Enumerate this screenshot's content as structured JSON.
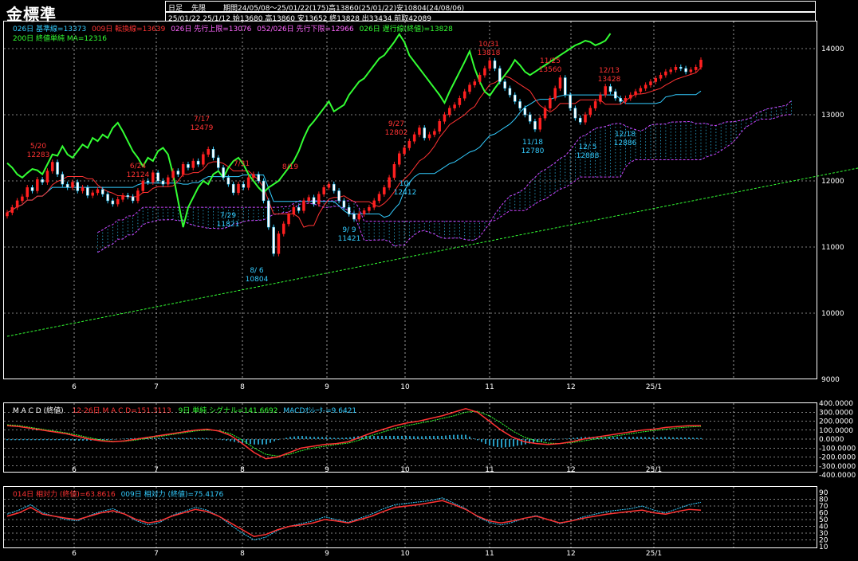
{
  "title": "金標準",
  "header": {
    "period_type": "日足",
    "contract": "先限",
    "range_info": "期間24/05/08～25/01/22(175)高13860(25/01/22)安10804(24/08/06)",
    "ohlc_info": "25/01/22 25/1/12 始13680 高13860 安13652 終13828 出33434 前取42089"
  },
  "legend": {
    "line1": [
      {
        "text": "026日 基準線=13373",
        "color": "#33ccff"
      },
      {
        "text": "009日 転換線=13639",
        "color": "#ff3333"
      },
      {
        "text": "026日 先行上限=13076",
        "color": "#ff66ff"
      },
      {
        "text": "052/026日 先行下限=12966",
        "color": "#ff66ff"
      },
      {
        "text": "026日 遅行線(終値)=13828",
        "color": "#33ff33"
      }
    ],
    "line2": [
      {
        "text": "200日 終値単純 MA=12316",
        "color": "#33ff33"
      }
    ]
  },
  "macd_legend": [
    {
      "text": "M A C D (終値)",
      "color": "#ffffff"
    },
    {
      "text": "12-26日 M A C D=151.3113",
      "color": "#ff3333"
    },
    {
      "text": "9日 単純 シグナル=141.6692",
      "color": "#33ff33"
    },
    {
      "text": "MACDｵｼﾚｰﾀ-=9.6421",
      "color": "#33ccff"
    }
  ],
  "rsi_legend": [
    {
      "text": "014日 相対力 (終値)=63.8616",
      "color": "#ff3333"
    },
    {
      "text": "009日 相対力 (終値)=75.4176",
      "color": "#33ccff"
    }
  ],
  "colors": {
    "background": "#000000",
    "up_candle": "#ff2020",
    "down_candle": "#33ccff",
    "kijun": "#33ccff",
    "tenkan": "#ff3333",
    "senkou": "#cc44ff",
    "cloud": "#33ccff",
    "chikou": "#33ff33",
    "ma200": "#33ff33",
    "macd": "#ff3333",
    "signal": "#33ff33",
    "osc": "#33ccff",
    "grid": "#ffffff"
  },
  "chart_data": [
    {
      "type": "candlestick",
      "name": "main",
      "y_ticks": [
        "14000",
        "13000",
        "12000",
        "11000",
        "10000",
        "9000"
      ],
      "ylim": [
        9000,
        14500
      ],
      "x_ticks": [
        "6",
        "7",
        "8",
        "9",
        "10",
        "11",
        "12",
        "25/1"
      ],
      "closes": [
        11520,
        11600,
        11700,
        11760,
        11900,
        11850,
        12020,
        11980,
        12150,
        12283,
        12100,
        11950,
        11900,
        11980,
        11850,
        11900,
        11780,
        11820,
        11870,
        11800,
        11700,
        11650,
        11720,
        11780,
        11760,
        11700,
        11850,
        12000,
        11980,
        12124,
        12000,
        11950,
        12050,
        12150,
        12100,
        12250,
        12200,
        12300,
        12250,
        12400,
        12479,
        12350,
        12200,
        12050,
        11950,
        11821,
        11950,
        11900,
        12050,
        12100,
        12000,
        11700,
        11300,
        10900,
        11200,
        11350,
        11500,
        11600,
        11550,
        11700,
        11750,
        11650,
        11800,
        11900,
        11950,
        11850,
        11700,
        11600,
        11500,
        11421,
        11500,
        11550,
        11600,
        11700,
        11800,
        11900,
        12050,
        12250,
        12412,
        12500,
        12600,
        12700,
        12802,
        12650,
        12700,
        12750,
        12900,
        13000,
        13100,
        13150,
        13250,
        13350,
        13450,
        13500,
        13600,
        13700,
        13818,
        13700,
        13500,
        13400,
        13300,
        13200,
        13100,
        13000,
        12900,
        12780,
        12950,
        13100,
        13250,
        13400,
        13560,
        13300,
        13100,
        12950,
        12888,
        13000,
        13100,
        13200,
        13300,
        13428,
        13350,
        13250,
        13200,
        13250,
        13300,
        13350,
        13400,
        13450,
        13500,
        13550,
        13600,
        13650,
        13680,
        13720,
        13700,
        13650,
        13680,
        13720,
        13828
      ],
      "annotations": [
        {
          "date_label": "5/20",
          "value": "12283",
          "kind": "high"
        },
        {
          "date_label": "6/24",
          "value": "12124",
          "kind": "high"
        },
        {
          "date_label": "7/17",
          "value": "12479",
          "kind": "high"
        },
        {
          "date_label": "7/31",
          "value": "",
          "kind": "high"
        },
        {
          "date_label": "8/19",
          "value": "",
          "kind": "high"
        },
        {
          "date_label": "9/27",
          "value": "12802",
          "kind": "high"
        },
        {
          "date_label": "10/31",
          "value": "13818",
          "kind": "high"
        },
        {
          "date_label": "11/25",
          "value": "13560",
          "kind": "high"
        },
        {
          "date_label": "12/13",
          "value": "13428",
          "kind": "high"
        },
        {
          "date_label": "7/29",
          "value": "11821",
          "kind": "low"
        },
        {
          "date_label": "8/ 6",
          "value": "10804",
          "kind": "low"
        },
        {
          "date_label": "9/ 9",
          "value": "11421",
          "kind": "low"
        },
        {
          "date_label": "10/",
          "value": "12412",
          "kind": "low"
        },
        {
          "date_label": "11/18",
          "value": "12780",
          "kind": "low"
        },
        {
          "date_label": "12/ 5",
          "value": "12888",
          "kind": "low"
        },
        {
          "date_label": "12/18",
          "value": "12886",
          "kind": "low"
        }
      ],
      "ma200": [
        [
          0,
          9650
        ],
        [
          175,
          12280
        ]
      ]
    },
    {
      "type": "line",
      "name": "macd",
      "y_ticks": [
        "400.0000",
        "300.0000",
        "200.0000",
        "100.0000",
        "0.0000",
        "-100.0000",
        "-200.0000",
        "-300.0000",
        "-400.0000"
      ],
      "ylim": [
        -420,
        420
      ],
      "x_ticks": [
        "6",
        "7",
        "8",
        "9",
        "10",
        "11",
        "12",
        "25/1"
      ],
      "macd": [
        150,
        140,
        120,
        100,
        80,
        60,
        30,
        0,
        -20,
        -30,
        -20,
        0,
        20,
        40,
        60,
        80,
        100,
        110,
        90,
        40,
        -50,
        -150,
        -220,
        -200,
        -150,
        -100,
        -80,
        -60,
        -50,
        -30,
        20,
        70,
        110,
        150,
        180,
        200,
        230,
        260,
        300,
        340,
        300,
        200,
        100,
        20,
        -30,
        -50,
        -60,
        -50,
        -30,
        0,
        20,
        40,
        60,
        80,
        100,
        110,
        130,
        140,
        150,
        151
      ],
      "signal": [
        160,
        150,
        130,
        110,
        90,
        70,
        45,
        15,
        -10,
        -25,
        -25,
        -10,
        10,
        30,
        50,
        70,
        90,
        100,
        95,
        60,
        -10,
        -100,
        -170,
        -190,
        -170,
        -130,
        -100,
        -80,
        -60,
        -45,
        -10,
        40,
        80,
        120,
        150,
        175,
        200,
        230,
        260,
        300,
        310,
        260,
        180,
        90,
        20,
        -20,
        -45,
        -50,
        -40,
        -20,
        0,
        20,
        40,
        60,
        80,
        95,
        110,
        125,
        135,
        141
      ]
    },
    {
      "type": "line",
      "name": "rsi",
      "y_ticks": [
        "90",
        "80",
        "70",
        "60",
        "50",
        "40",
        "30",
        "20",
        "10"
      ],
      "ylim": [
        5,
        92
      ],
      "x_ticks": [
        "6",
        "7",
        "8",
        "9",
        "10",
        "11",
        "12",
        "25/1"
      ],
      "rsi14": [
        55,
        60,
        68,
        58,
        55,
        52,
        50,
        55,
        60,
        63,
        58,
        50,
        45,
        48,
        55,
        60,
        65,
        62,
        55,
        45,
        35,
        25,
        28,
        35,
        40,
        42,
        45,
        50,
        48,
        45,
        50,
        55,
        62,
        68,
        70,
        72,
        75,
        78,
        72,
        65,
        55,
        48,
        45,
        48,
        52,
        55,
        50,
        45,
        48,
        52,
        55,
        58,
        60,
        62,
        64,
        60,
        58,
        62,
        65,
        63.86
      ],
      "rsi9": [
        58,
        64,
        72,
        60,
        55,
        50,
        48,
        56,
        62,
        66,
        58,
        48,
        42,
        46,
        56,
        62,
        68,
        64,
        55,
        42,
        30,
        20,
        24,
        34,
        40,
        44,
        48,
        54,
        50,
        46,
        52,
        58,
        66,
        72,
        74,
        76,
        78,
        82,
        74,
        66,
        54,
        46,
        42,
        46,
        52,
        56,
        50,
        44,
        48,
        54,
        58,
        62,
        64,
        66,
        70,
        64,
        60,
        66,
        72,
        75.42
      ]
    }
  ]
}
